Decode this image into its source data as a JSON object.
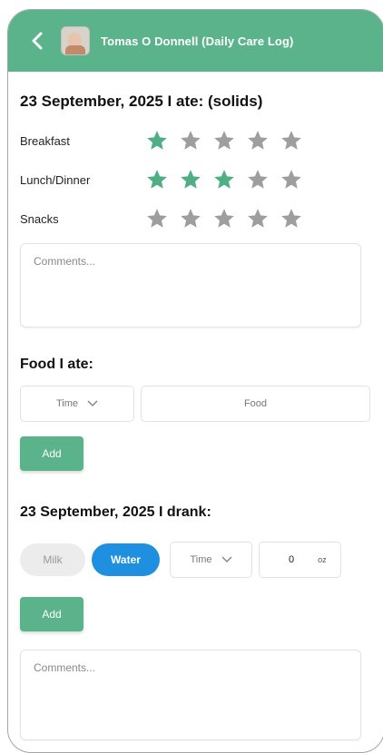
{
  "header": {
    "title": "Tomas O Donnell (Daily Care Log)",
    "back_icon": "chevron-left-icon",
    "avatar_icon": "profile-photo"
  },
  "solids": {
    "heading": "23 September, 2025 I ate: (solids)",
    "ratings": [
      {
        "label": "Breakfast",
        "value": 1,
        "max": 5
      },
      {
        "label": "Lunch/Dinner",
        "value": 3,
        "max": 5
      },
      {
        "label": "Snacks",
        "value": 0,
        "max": 5
      }
    ],
    "comments_placeholder": "Comments..."
  },
  "food": {
    "heading": "Food I ate:",
    "time_placeholder": "Time",
    "food_placeholder": "Food",
    "add_label": "Add"
  },
  "drinks": {
    "heading": "23 September, 2025 I drank:",
    "milk_label": "Milk",
    "water_label": "Water",
    "selected": "Water",
    "time_placeholder": "Time",
    "amount_value": "0",
    "unit": "oz",
    "add_label": "Add",
    "comments_placeholder": "Comments..."
  },
  "colors": {
    "accent": "#5bb38b",
    "star_filled": "#4fae84",
    "star_empty": "#9e9e9e",
    "water_selected": "#1f8fe0",
    "milk_bg": "#ececec"
  }
}
